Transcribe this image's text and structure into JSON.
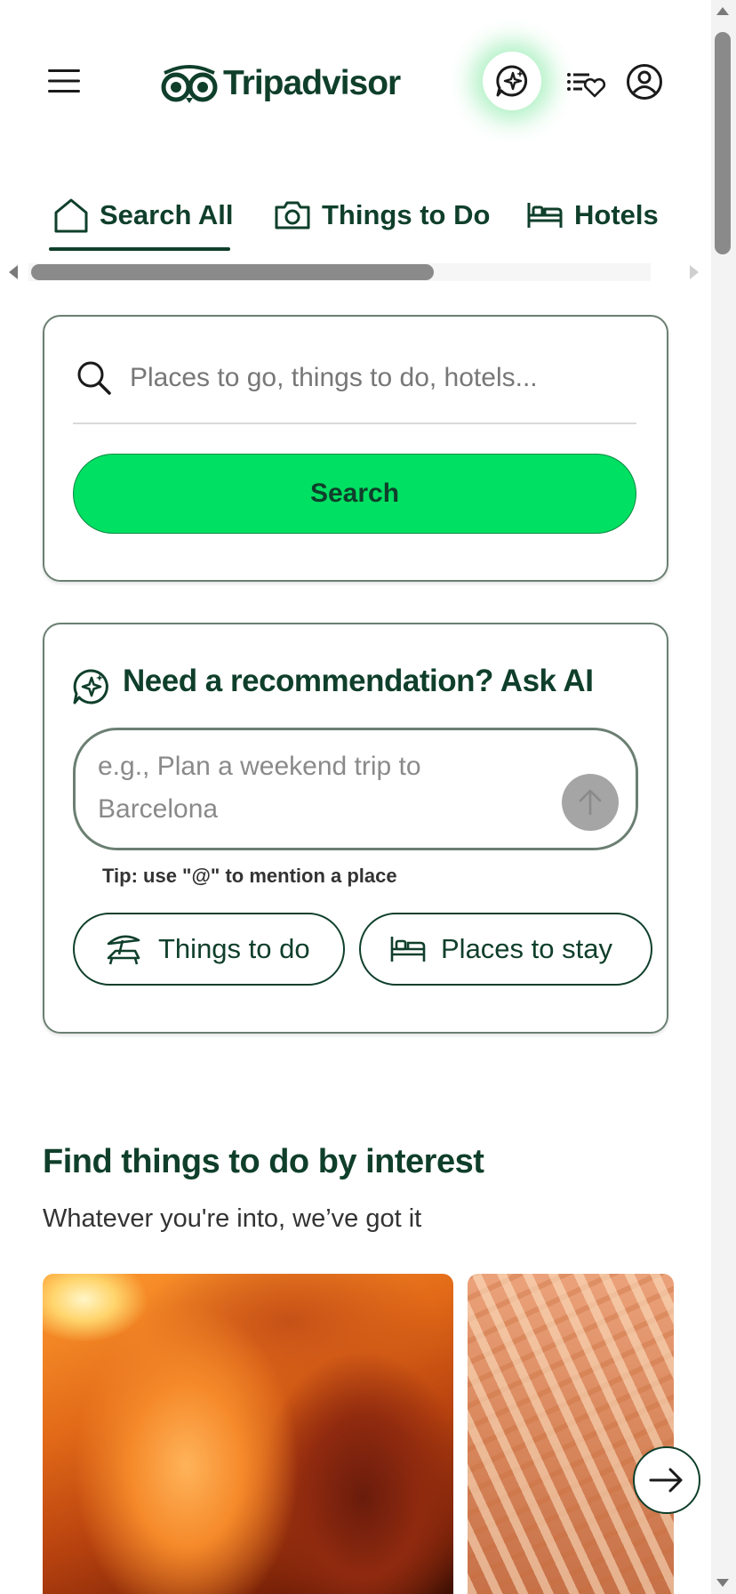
{
  "header": {
    "logo_text": "Tripadvisor",
    "menu_icon": "hamburger-menu-icon",
    "ai_icon": "ai-sparkle-chat-icon",
    "trips_icon": "trips-list-heart-icon",
    "profile_icon": "user-profile-icon",
    "brand_color": "#0f3f2b",
    "accent_color": "#00e062"
  },
  "tabs": [
    {
      "label": "Search All",
      "icon": "home-icon",
      "selected": true
    },
    {
      "label": "Things to Do",
      "icon": "camera-icon",
      "selected": false
    },
    {
      "label": "Hotels",
      "icon": "bed-icon",
      "selected": false
    }
  ],
  "search": {
    "placeholder": "Places to go, things to do, hotels...",
    "value": "",
    "button_label": "Search"
  },
  "ai": {
    "title": "Need a recommendation? Ask AI",
    "placeholder": "e.g., Plan a weekend trip to Barcelona",
    "tip": "Tip: use \"@\" to mention a place",
    "chips": [
      {
        "label": "Things to do",
        "icon": "beach-chair-icon"
      },
      {
        "label": "Places to stay",
        "icon": "bed-icon"
      }
    ]
  },
  "interest": {
    "title": "Find things to do by interest",
    "subtitle": "Whatever you're into, we’ve got it"
  }
}
